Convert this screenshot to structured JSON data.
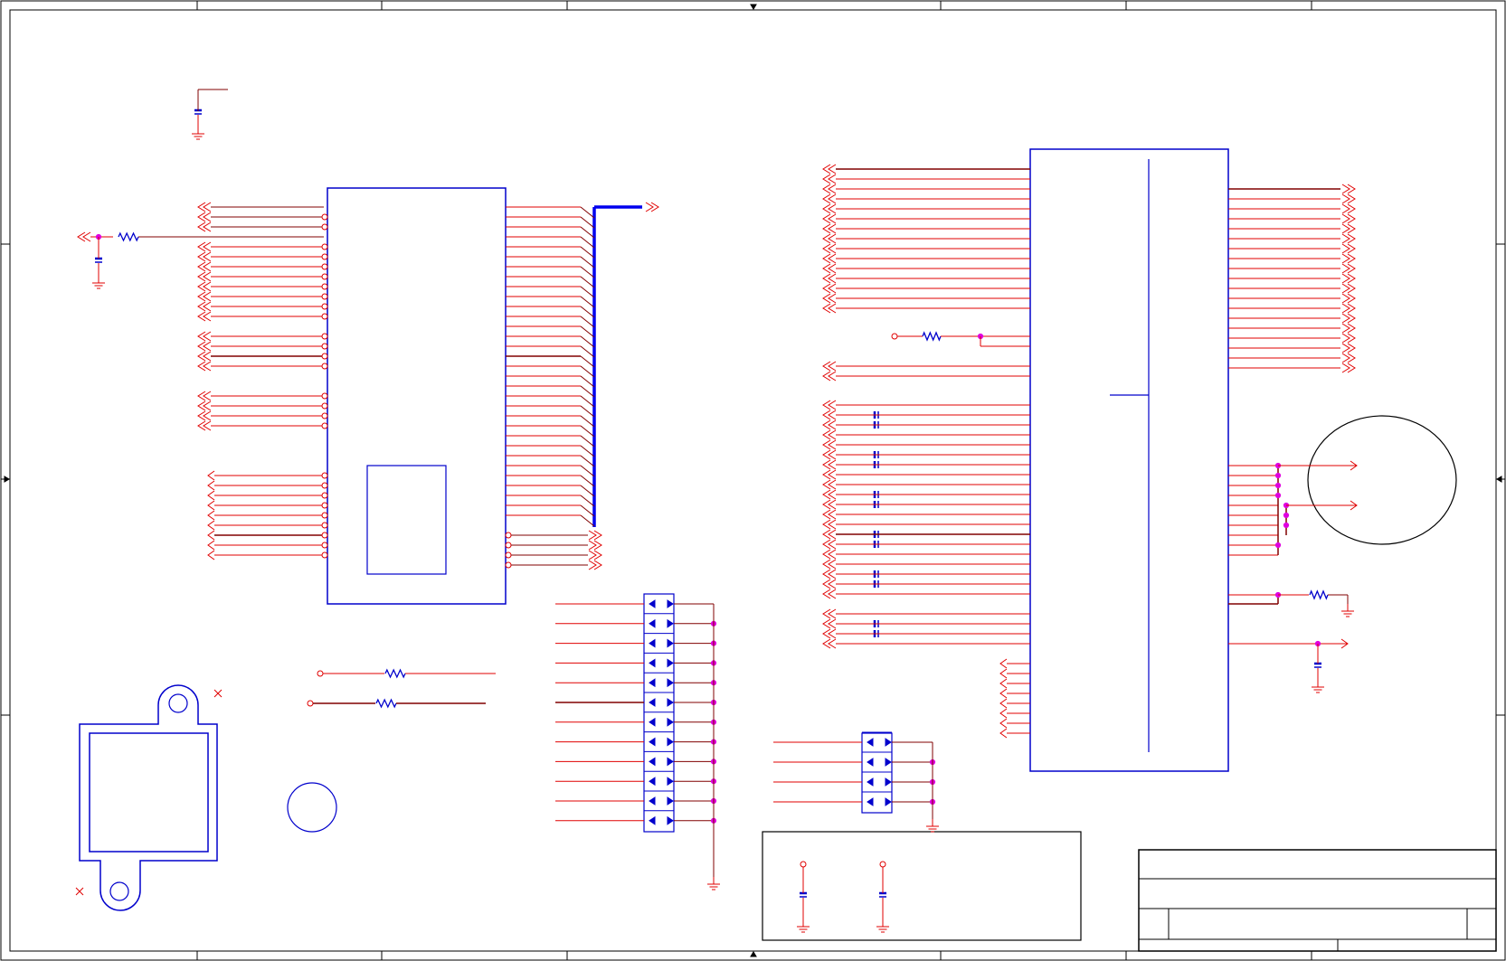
{
  "sheet": {
    "title": "",
    "title_block_fields": []
  },
  "colors": {
    "wire": "#e00000",
    "bus": "#0000ee",
    "part": "#0000cc",
    "junction": "#e000e0",
    "frame": "#000000",
    "dark_wire": "#800000",
    "background": "#ffffff"
  },
  "symbols": {
    "ic_left": "ic-body",
    "ic_middle": "ic-body",
    "ic_right": "ic-body",
    "diode_array_1": "diode-array",
    "diode_array_2": "diode-array",
    "connector": "connector-footprint",
    "mount_hole": "mounting-hole",
    "unused_marker": "no-connect-x",
    "ground": "ground-symbol",
    "resistor": "resistor-zigzag",
    "capacitor": "capacitor-symbol",
    "port": "port-arrow"
  }
}
